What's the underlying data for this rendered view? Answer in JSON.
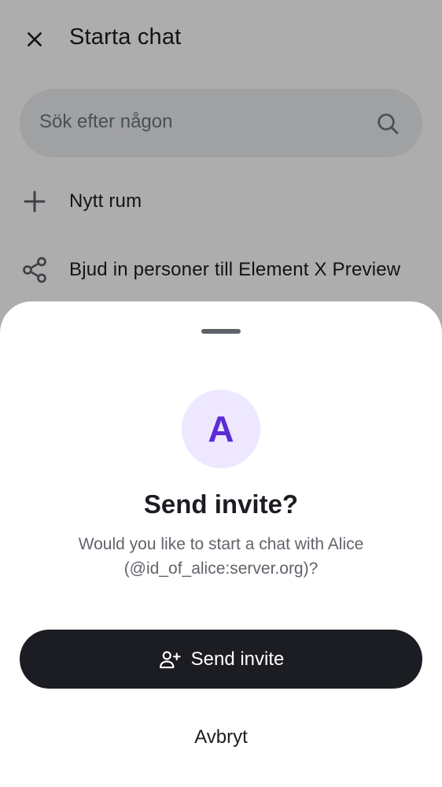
{
  "header": {
    "title": "Starta chat",
    "close_icon": "close-icon"
  },
  "search": {
    "placeholder": "Sök efter någon",
    "icon": "search-icon"
  },
  "actions": [
    {
      "label": "Nytt rum",
      "icon": "plus-icon"
    },
    {
      "label": "Bjud in personer till Element X Preview",
      "icon": "share-icon"
    }
  ],
  "sheet": {
    "avatar_letter": "A",
    "title": "Send invite?",
    "description": "Would you like to start a chat with Alice (@id_of_alice:server.org)?",
    "primary_button": {
      "label": "Send invite",
      "icon": "person-add-icon"
    },
    "cancel_button": {
      "label": "Avbryt"
    }
  },
  "colors": {
    "accent": "#5a2bd6",
    "avatar_bg": "#ede8ff",
    "primary_button_bg": "#1b1d22"
  }
}
